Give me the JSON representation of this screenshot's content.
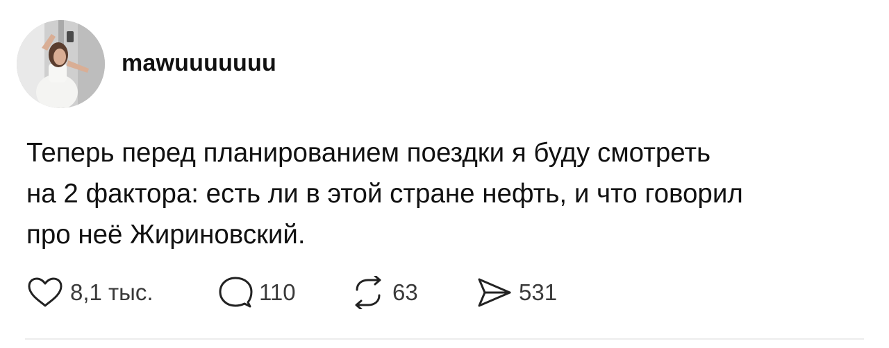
{
  "post": {
    "username": "mawuuuuuuu",
    "text_lines": [
      "Теперь перед планированием поездки я буду смотреть",
      "на 2 фактора: есть ли в этой стране нефть, и что говорил",
      "про неё Жириновский."
    ]
  },
  "actions": {
    "like": {
      "icon": "heart-icon",
      "count": "8,1 тыс."
    },
    "reply": {
      "icon": "speech-bubble-icon",
      "count": "110"
    },
    "repost": {
      "icon": "repost-arrows-icon",
      "count": "63"
    },
    "share": {
      "icon": "send-icon",
      "count": "531"
    }
  },
  "colors": {
    "text": "#111111",
    "secondary_text": "#3a3a3a",
    "divider": "#ececec",
    "background": "#ffffff"
  }
}
